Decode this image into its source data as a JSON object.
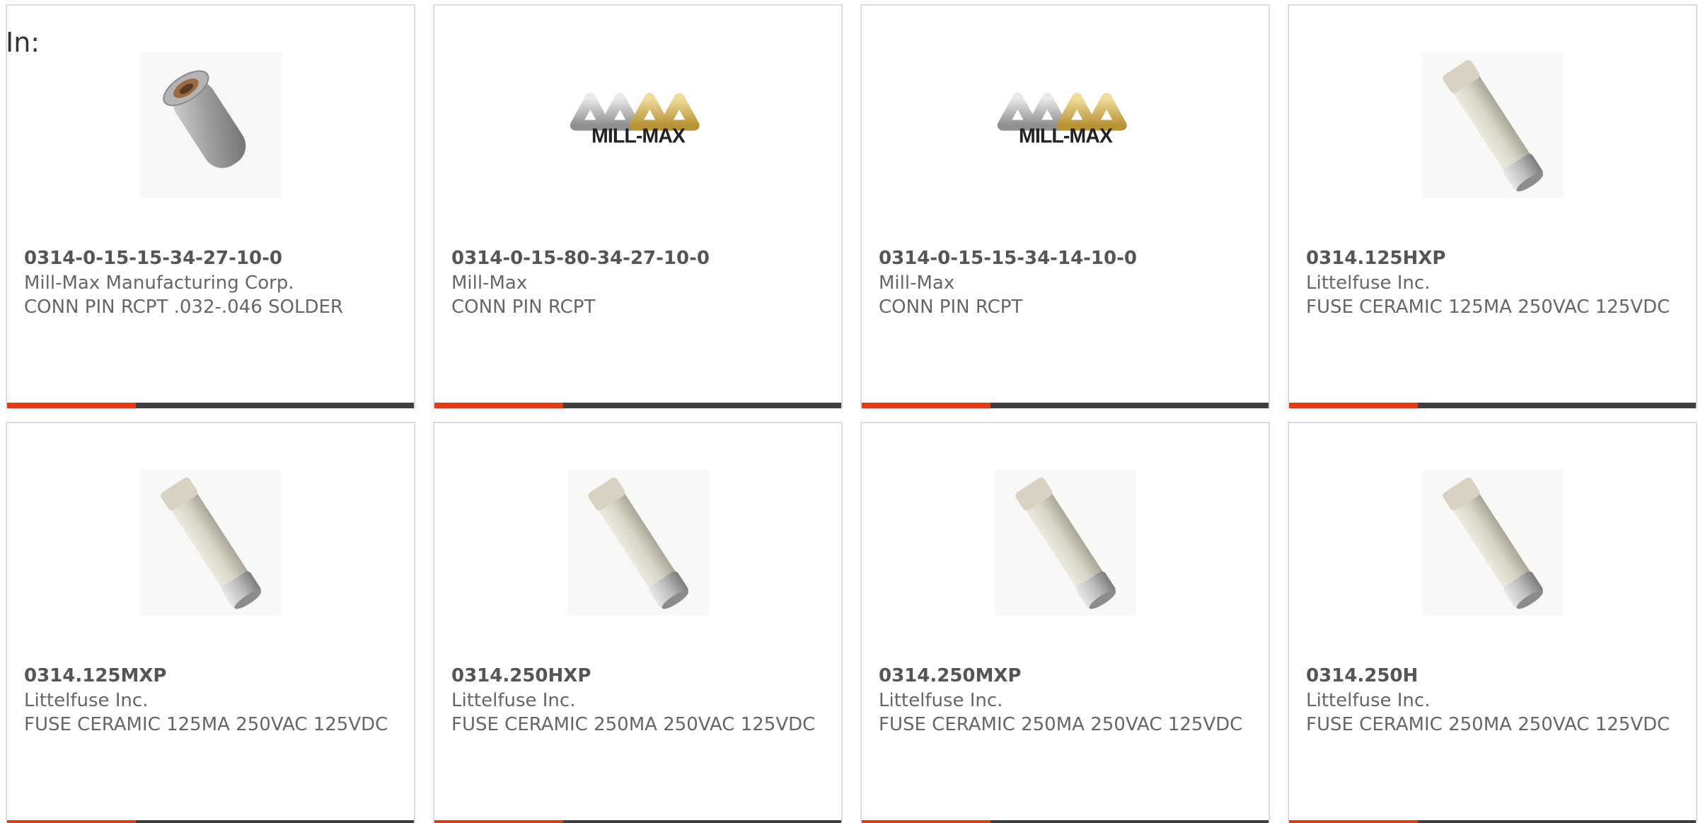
{
  "header": {
    "in_label": "In:"
  },
  "colors": {
    "accent": "#e03c16",
    "bar": "#3f3f3f",
    "border": "#dcdcdc"
  },
  "products": [
    {
      "part_number": "0314-0-15-15-34-27-10-0",
      "manufacturer": "Mill-Max Manufacturing Corp.",
      "description": "CONN PIN RCPT .032-.046 SOLDER",
      "image": "pin-receptacle-photo"
    },
    {
      "part_number": "0314-0-15-80-34-27-10-0",
      "manufacturer": "Mill-Max",
      "description": "CONN PIN RCPT",
      "image": "mill-max-logo",
      "logo_text": "MILL-MAX"
    },
    {
      "part_number": "0314-0-15-15-34-14-10-0",
      "manufacturer": "Mill-Max",
      "description": "CONN PIN RCPT",
      "image": "mill-max-logo",
      "logo_text": "MILL-MAX"
    },
    {
      "part_number": "0314.125HXP",
      "manufacturer": "Littelfuse Inc.",
      "description": "FUSE CERAMIC 125MA 250VAC 125VDC",
      "image": "ceramic-fuse-photo"
    },
    {
      "part_number": "0314.125MXP",
      "manufacturer": "Littelfuse Inc.",
      "description": "FUSE CERAMIC 125MA 250VAC 125VDC",
      "image": "ceramic-fuse-photo"
    },
    {
      "part_number": "0314.250HXP",
      "manufacturer": "Littelfuse Inc.",
      "description": "FUSE CERAMIC 250MA 250VAC 125VDC",
      "image": "ceramic-fuse-photo"
    },
    {
      "part_number": "0314.250MXP",
      "manufacturer": "Littelfuse Inc.",
      "description": "FUSE CERAMIC 250MA 250VAC 125VDC",
      "image": "ceramic-fuse-photo"
    },
    {
      "part_number": "0314.250H",
      "manufacturer": "Littelfuse Inc.",
      "description": "FUSE CERAMIC 250MA 250VAC 125VDC",
      "image": "ceramic-fuse-photo"
    }
  ]
}
